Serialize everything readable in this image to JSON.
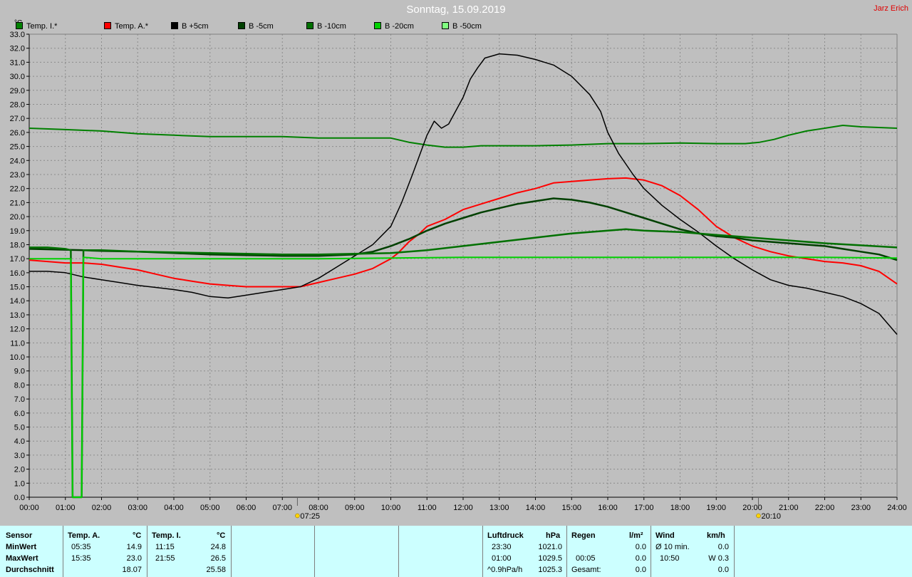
{
  "header": {
    "title": "Sonntag, 15.09.2019",
    "author": "Jarz Erich"
  },
  "chart_data": {
    "type": "line",
    "unit_label": "°C",
    "ylim": [
      0,
      33
    ],
    "y_ticks": [
      "0.0",
      "1.0",
      "2.0",
      "3.0",
      "4.0",
      "5.0",
      "6.0",
      "7.0",
      "8.0",
      "9.0",
      "10.0",
      "11.0",
      "12.0",
      "13.0",
      "14.0",
      "15.0",
      "16.0",
      "17.0",
      "18.0",
      "19.0",
      "20.0",
      "21.0",
      "22.0",
      "23.0",
      "24.0",
      "25.0",
      "26.0",
      "27.0",
      "28.0",
      "29.0",
      "30.0",
      "31.0",
      "32.0",
      "33.0"
    ],
    "x_ticks": [
      "00:00",
      "01:00",
      "02:00",
      "03:00",
      "04:00",
      "05:00",
      "06:00",
      "07:00",
      "08:00",
      "09:00",
      "10:00",
      "11:00",
      "12:00",
      "13:00",
      "14:00",
      "15:00",
      "16:00",
      "17:00",
      "18:00",
      "19:00",
      "20:00",
      "21:00",
      "22:00",
      "23:00",
      "24:00"
    ],
    "xlim_hours": [
      0,
      24
    ],
    "grid": true,
    "legend_position": "top-left",
    "markers": [
      {
        "label": "07:25",
        "hour": 7.417,
        "icon": "sunrise-icon"
      },
      {
        "label": "20:10",
        "hour": 20.167,
        "icon": "sunset-icon"
      }
    ],
    "series": [
      {
        "name": "Temp. I.*",
        "color": "#008000",
        "width": 2,
        "points": [
          [
            0,
            26.3
          ],
          [
            1,
            26.2
          ],
          [
            2,
            26.1
          ],
          [
            3,
            25.9
          ],
          [
            4,
            25.8
          ],
          [
            5,
            25.7
          ],
          [
            6,
            25.7
          ],
          [
            7,
            25.7
          ],
          [
            8,
            25.6
          ],
          [
            9,
            25.6
          ],
          [
            10,
            25.6
          ],
          [
            10.5,
            25.3
          ],
          [
            11,
            25.1
          ],
          [
            11.5,
            24.95
          ],
          [
            12,
            24.95
          ],
          [
            12.5,
            25.05
          ],
          [
            13,
            25.05
          ],
          [
            14,
            25.05
          ],
          [
            15,
            25.1
          ],
          [
            16,
            25.2
          ],
          [
            17,
            25.2
          ],
          [
            18,
            25.25
          ],
          [
            19,
            25.2
          ],
          [
            19.8,
            25.2
          ],
          [
            20.2,
            25.3
          ],
          [
            20.6,
            25.5
          ],
          [
            21,
            25.8
          ],
          [
            21.5,
            26.1
          ],
          [
            22,
            26.3
          ],
          [
            22.5,
            26.5
          ],
          [
            23,
            26.4
          ],
          [
            24,
            26.3
          ]
        ]
      },
      {
        "name": "Temp. A.*",
        "color": "#ff0000",
        "width": 2,
        "points": [
          [
            0,
            16.9
          ],
          [
            0.5,
            16.8
          ],
          [
            1,
            16.7
          ],
          [
            1.5,
            16.7
          ],
          [
            2,
            16.6
          ],
          [
            2.5,
            16.4
          ],
          [
            3,
            16.2
          ],
          [
            3.5,
            15.9
          ],
          [
            4,
            15.6
          ],
          [
            4.5,
            15.4
          ],
          [
            5,
            15.2
          ],
          [
            5.5,
            15.1
          ],
          [
            6,
            15.0
          ],
          [
            7,
            15.0
          ],
          [
            7.5,
            15.0
          ],
          [
            8,
            15.3
          ],
          [
            8.5,
            15.6
          ],
          [
            9,
            15.9
          ],
          [
            9.5,
            16.3
          ],
          [
            10,
            17.0
          ],
          [
            10.2,
            17.4
          ],
          [
            10.5,
            18.2
          ],
          [
            10.8,
            18.8
          ],
          [
            11,
            19.3
          ],
          [
            11.5,
            19.8
          ],
          [
            12,
            20.5
          ],
          [
            12.5,
            20.9
          ],
          [
            13,
            21.3
          ],
          [
            13.5,
            21.7
          ],
          [
            14,
            22.0
          ],
          [
            14.5,
            22.4
          ],
          [
            15,
            22.5
          ],
          [
            15.5,
            22.6
          ],
          [
            16,
            22.7
          ],
          [
            16.5,
            22.75
          ],
          [
            17,
            22.6
          ],
          [
            17.5,
            22.2
          ],
          [
            18,
            21.5
          ],
          [
            18.5,
            20.5
          ],
          [
            19,
            19.3
          ],
          [
            19.5,
            18.5
          ],
          [
            20,
            17.9
          ],
          [
            20.5,
            17.5
          ],
          [
            21,
            17.2
          ],
          [
            21.5,
            17.0
          ],
          [
            22,
            16.8
          ],
          [
            22.5,
            16.7
          ],
          [
            23,
            16.5
          ],
          [
            23.5,
            16.1
          ],
          [
            24,
            15.2
          ]
        ]
      },
      {
        "name": "B +5cm",
        "color": "#000000",
        "width": 1.5,
        "points": [
          [
            0,
            16.1
          ],
          [
            0.5,
            16.1
          ],
          [
            1,
            16.0
          ],
          [
            1.5,
            15.7
          ],
          [
            2,
            15.5
          ],
          [
            2.5,
            15.3
          ],
          [
            3,
            15.1
          ],
          [
            3.5,
            14.95
          ],
          [
            4,
            14.8
          ],
          [
            4.5,
            14.6
          ],
          [
            5,
            14.3
          ],
          [
            5.5,
            14.2
          ],
          [
            6,
            14.4
          ],
          [
            6.5,
            14.6
          ],
          [
            7,
            14.8
          ],
          [
            7.5,
            15.0
          ],
          [
            8,
            15.6
          ],
          [
            8.5,
            16.4
          ],
          [
            9,
            17.2
          ],
          [
            9.5,
            18.0
          ],
          [
            10,
            19.3
          ],
          [
            10.3,
            21.0
          ],
          [
            10.6,
            23.0
          ],
          [
            11,
            25.8
          ],
          [
            11.2,
            26.8
          ],
          [
            11.4,
            26.3
          ],
          [
            11.6,
            26.6
          ],
          [
            12,
            28.5
          ],
          [
            12.2,
            29.8
          ],
          [
            12.4,
            30.6
          ],
          [
            12.6,
            31.3
          ],
          [
            13,
            31.6
          ],
          [
            13.5,
            31.5
          ],
          [
            14,
            31.2
          ],
          [
            14.5,
            30.8
          ],
          [
            15,
            30.0
          ],
          [
            15.5,
            28.7
          ],
          [
            15.8,
            27.5
          ],
          [
            16,
            26.0
          ],
          [
            16.3,
            24.5
          ],
          [
            16.7,
            23.0
          ],
          [
            17,
            22.0
          ],
          [
            17.5,
            20.8
          ],
          [
            18,
            19.8
          ],
          [
            18.5,
            18.9
          ],
          [
            19,
            17.9
          ],
          [
            19.5,
            17.0
          ],
          [
            20,
            16.2
          ],
          [
            20.5,
            15.5
          ],
          [
            21,
            15.1
          ],
          [
            21.5,
            14.9
          ],
          [
            22,
            14.6
          ],
          [
            22.5,
            14.3
          ],
          [
            23,
            13.8
          ],
          [
            23.5,
            13.1
          ],
          [
            24,
            11.6
          ]
        ]
      },
      {
        "name": "B -5cm",
        "color": "#004000",
        "width": 2.5,
        "points": [
          [
            0,
            17.7
          ],
          [
            1.5,
            17.6
          ],
          [
            2,
            17.55
          ],
          [
            3,
            17.5
          ],
          [
            4,
            17.4
          ],
          [
            5,
            17.3
          ],
          [
            6,
            17.25
          ],
          [
            7,
            17.2
          ],
          [
            8,
            17.2
          ],
          [
            9,
            17.3
          ],
          [
            9.5,
            17.5
          ],
          [
            10,
            17.9
          ],
          [
            10.5,
            18.4
          ],
          [
            11,
            19.0
          ],
          [
            11.5,
            19.5
          ],
          [
            12,
            19.9
          ],
          [
            12.5,
            20.3
          ],
          [
            13,
            20.6
          ],
          [
            13.5,
            20.9
          ],
          [
            14,
            21.1
          ],
          [
            14.5,
            21.3
          ],
          [
            15,
            21.2
          ],
          [
            15.5,
            21.0
          ],
          [
            16,
            20.7
          ],
          [
            16.5,
            20.3
          ],
          [
            17,
            19.9
          ],
          [
            17.5,
            19.5
          ],
          [
            18,
            19.1
          ],
          [
            18.5,
            18.8
          ],
          [
            19,
            18.6
          ],
          [
            19.5,
            18.5
          ],
          [
            20,
            18.3
          ],
          [
            20.5,
            18.2
          ],
          [
            21,
            18.1
          ],
          [
            21.5,
            18.0
          ],
          [
            22,
            17.9
          ],
          [
            22.5,
            17.7
          ],
          [
            23,
            17.5
          ],
          [
            23.5,
            17.3
          ],
          [
            24,
            16.9
          ]
        ]
      },
      {
        "name": "B -10cm",
        "color": "#007000",
        "width": 2.5,
        "points": [
          [
            0,
            17.8
          ],
          [
            0.5,
            17.8
          ],
          [
            1,
            17.7
          ],
          [
            1.15,
            17.6
          ],
          [
            1.2,
            0.0
          ],
          [
            1.45,
            0.0
          ],
          [
            1.5,
            17.6
          ],
          [
            2,
            17.6
          ],
          [
            3,
            17.5
          ],
          [
            4,
            17.45
          ],
          [
            5,
            17.4
          ],
          [
            6,
            17.35
          ],
          [
            7,
            17.3
          ],
          [
            8,
            17.3
          ],
          [
            9,
            17.35
          ],
          [
            10,
            17.4
          ],
          [
            11,
            17.6
          ],
          [
            12,
            17.9
          ],
          [
            13,
            18.2
          ],
          [
            14,
            18.5
          ],
          [
            15,
            18.8
          ],
          [
            16,
            19.0
          ],
          [
            16.5,
            19.1
          ],
          [
            17,
            19.0
          ],
          [
            18,
            18.9
          ],
          [
            19,
            18.7
          ],
          [
            20,
            18.5
          ],
          [
            21,
            18.3
          ],
          [
            22,
            18.1
          ],
          [
            23,
            17.95
          ],
          [
            24,
            17.8
          ]
        ]
      },
      {
        "name": "B -20cm",
        "color": "#00d000",
        "width": 2,
        "points": [
          [
            0,
            17.0
          ],
          [
            1,
            17.0
          ],
          [
            1.15,
            17.0
          ],
          [
            1.2,
            0.0
          ],
          [
            1.45,
            0.0
          ],
          [
            1.5,
            17.1
          ],
          [
            2,
            17.0
          ],
          [
            4,
            17.0
          ],
          [
            6,
            17.0
          ],
          [
            8,
            17.0
          ],
          [
            10,
            17.05
          ],
          [
            12,
            17.1
          ],
          [
            14,
            17.1
          ],
          [
            16,
            17.1
          ],
          [
            18,
            17.1
          ],
          [
            20,
            17.1
          ],
          [
            22,
            17.1
          ],
          [
            24,
            17.05
          ]
        ]
      },
      {
        "name": "B -50cm",
        "color": "#80ff80",
        "width": 1,
        "points": []
      }
    ]
  },
  "stats": {
    "sensor_header": "Sensor",
    "row_labels": [
      "MinWert",
      "MaxWert",
      "Durchschnitt"
    ],
    "temp_a": {
      "header": "Temp. A.",
      "unit": "°C",
      "min_time": "05:35",
      "min_val": "14.9",
      "max_time": "15:35",
      "max_val": "23.0",
      "avg": "18.07"
    },
    "temp_i": {
      "header": "Temp. I.",
      "unit": "°C",
      "min_time": "11:15",
      "min_val": "24.8",
      "max_time": "21:55",
      "max_val": "26.5",
      "avg": "25.58"
    },
    "pressure": {
      "header": "Luftdruck",
      "unit": "hPa",
      "min_time": "23:30",
      "min_val": "1021.0",
      "max_time": "01:00",
      "max_val": "1029.5",
      "trend_label": "^0.9hPa/h",
      "trend_val": "1025.3"
    },
    "rain": {
      "header": "Regen",
      "unit": "l/m²",
      "row1_label": "00:05",
      "row1_val": "0.0",
      "row2_label": "Gesamt:",
      "row2_val": "0.0",
      "row0_val": "0.0"
    },
    "wind": {
      "header": "Wind",
      "unit": "km/h",
      "row0_label": "Ø 10 min.",
      "row0_val": "0.0",
      "row1_label": "10:50",
      "row1_val": "W 0.3",
      "row2_val": "0.0"
    }
  }
}
